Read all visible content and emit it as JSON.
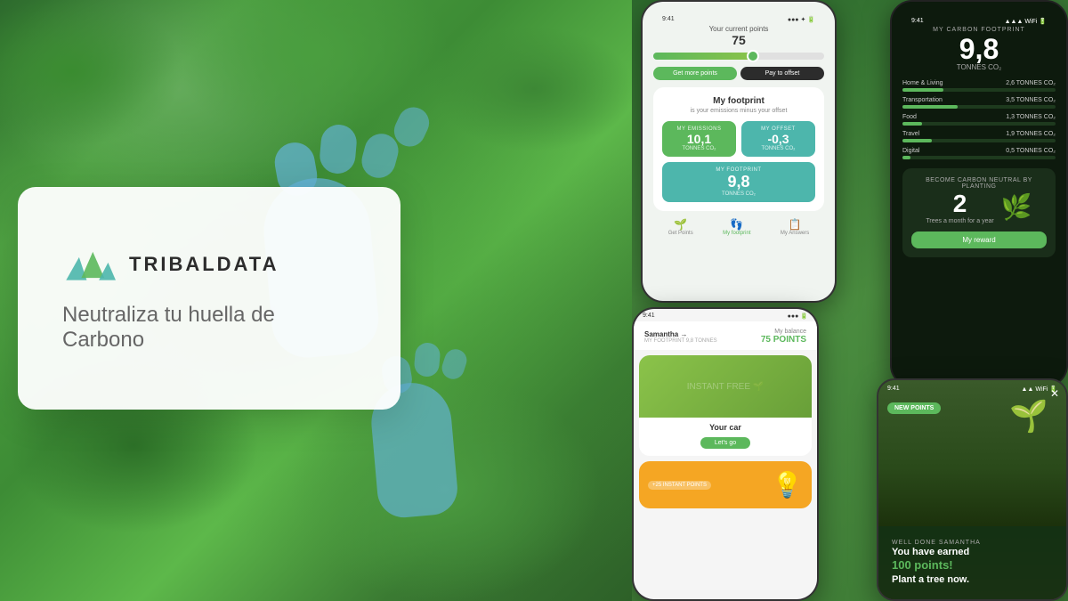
{
  "brand": {
    "name": "TRIBALDATA",
    "tagline": "Neutraliza tu huella de Carbono",
    "logo_alt": "TribalData Logo"
  },
  "phone1": {
    "points_label": "Your current points",
    "points_value": "75",
    "btn_more": "Get more points",
    "btn_offset": "Pay to offset",
    "footprint_title": "My footprint",
    "footprint_sub": "is your emissions minus your offset",
    "emissions_label": "MY EMISSIONS",
    "emissions_value": "10,1",
    "emissions_unit": "TONNES CO₂",
    "offset_label": "MY OFFSET",
    "offset_value": "-0,3",
    "offset_unit": "TONNES CO₂",
    "footprint_label": "MY FOOTPRINT",
    "footprint_value": "9,8",
    "footprint_unit": "TONNES CO₂",
    "nav_points": "Get Points",
    "nav_footprint": "My footprint",
    "nav_answers": "My Answers"
  },
  "phone2": {
    "title": "MY CARBON FOOTPRINT",
    "value": "9,8",
    "unit": "TONNES CO₂",
    "bars": [
      {
        "label": "Home & Living",
        "value": "2,6 TONNES CO₂",
        "pct": 27
      },
      {
        "label": "Transportation",
        "value": "3,5 TONNES CO₂",
        "pct": 36
      },
      {
        "label": "Food",
        "value": "1,3 TONNES CO₂",
        "pct": 13
      },
      {
        "label": "Travel",
        "value": "1,9 TONNES CO₂",
        "pct": 19
      },
      {
        "label": "Digital",
        "value": "0,5 TONNES CO₂",
        "pct": 5
      }
    ],
    "neutral_title": "BECOME CARBON NEUTRAL BY PLANTING",
    "neutral_number": "2",
    "neutral_sub": "Trees a month for a year",
    "neutral_btn": "My reward"
  },
  "phone3": {
    "status_time": "9:41",
    "user": "Samantha →",
    "user_sub": "MY FOOTPRINT 9,8 TONNES",
    "balance_label": "My balance",
    "balance_value": "75 POINTS",
    "card1_label": "INSTANT FREE",
    "card1_title": "Your car",
    "card1_btn": "Let's go",
    "card2_label": "+25 INSTANT POINTS"
  },
  "phone4": {
    "status_time": "9:41",
    "badge": "NEW POINTS",
    "well_done": "WELL DONE SAMANTHA",
    "line1": "You have earned",
    "points": "100 points!",
    "line2": "Plant a tree now."
  },
  "colors": {
    "green_primary": "#5cb85c",
    "green_dark": "#2d6a2d",
    "teal": "#4db6ac",
    "dark_bg": "#0d1a0d"
  }
}
